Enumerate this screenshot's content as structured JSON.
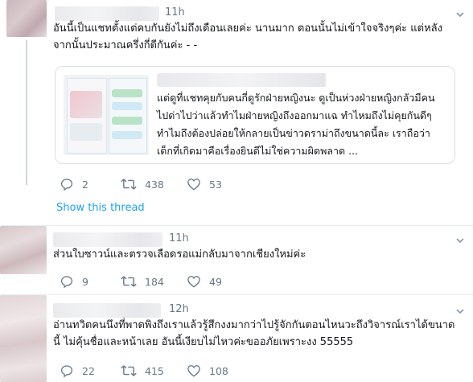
{
  "tweets": [
    {
      "time": "11h",
      "text": "อันนี้เป็นแชทตั้งแต่คบกันยังไม่ถึงเดือนเลยค่ะ นานมาก ตอนนั้นไม่เข้าใจจริงๆค่ะ แต่หลังจากนั้นประมาณครึ่งกี่ดีกันค่ะ - -",
      "card": {
        "text": "แต่ดูที่แชทคุยกับคนกี่ดูรักฝ่ายหญิงนะ ดูเป็นห่วงฝ่ายหญิงกลัวมีคนไปด่าไปว่าแล้วทำไมฝ่ายหญิงถึงออกมาแฉ ทำไหมถึงไม่คุยกันดีๆ ทำไมถึงต้องปล่อยให้กลายเป็นข่าวดราม่าถึงขนาดนี้ละ เราถือว่าเด็กที่เกิดมาคือเรื่องยินดีไม่ใช่ความผิดพลาด ..."
      },
      "replies": "2",
      "retweets": "438",
      "likes": "53",
      "show_thread": "Show this thread"
    },
    {
      "time": "11h",
      "text": "ส่วนใบซาวน์และตรวจเลือดรอแม่กลับมาจากเชียงใหม่ค่ะ",
      "replies": "9",
      "retweets": "184",
      "likes": "49"
    },
    {
      "time": "12h",
      "text": "อ่านทวิตคนนึงที่พาดพิงถึงเราแล้วรู้สึกงงมากว่าไปรู้จักกันตอนไหนวะถึงวิจารณ์เราได้ขนาดนี้ ไม่คุ้นชื่อและหน้าเลย อันนี้เงียบไม่ไหวค่ะขออภัยเพราะงง 55555",
      "replies": "22",
      "retweets": "415",
      "likes": "108"
    }
  ],
  "colors": {
    "text": "#14171a",
    "muted": "#657786",
    "link": "#1da1f2",
    "divider": "#e6ecf0"
  },
  "icons": [
    "reply-icon",
    "retweet-icon",
    "like-icon",
    "chevron-down-icon"
  ]
}
